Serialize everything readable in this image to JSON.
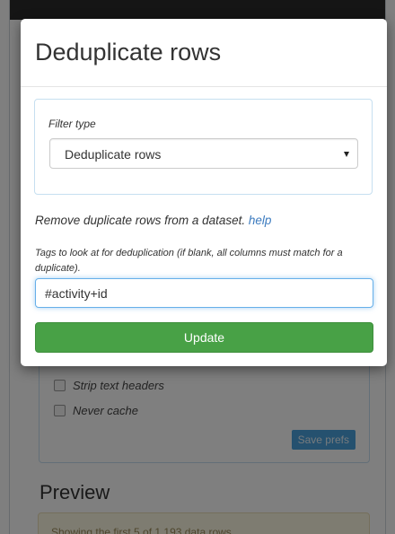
{
  "modal": {
    "title": "Deduplicate rows",
    "filter_type_label": "Filter type",
    "filter_type_value": "Deduplicate rows",
    "description": "Remove duplicate rows from a dataset.",
    "help_link": "help",
    "tags_label": "Tags to look at for deduplication (if blank, all columns must match for a duplicate).",
    "tags_value": "#activity+id",
    "update_label": "Update"
  },
  "background": {
    "prefs": {
      "strip_text_headers_label": "Strip text headers",
      "never_cache_label": "Never cache",
      "save_prefs_label": "Save prefs"
    },
    "preview_heading": "Preview",
    "preview_text": "Showing the first 5 of 1,193 data rows"
  }
}
